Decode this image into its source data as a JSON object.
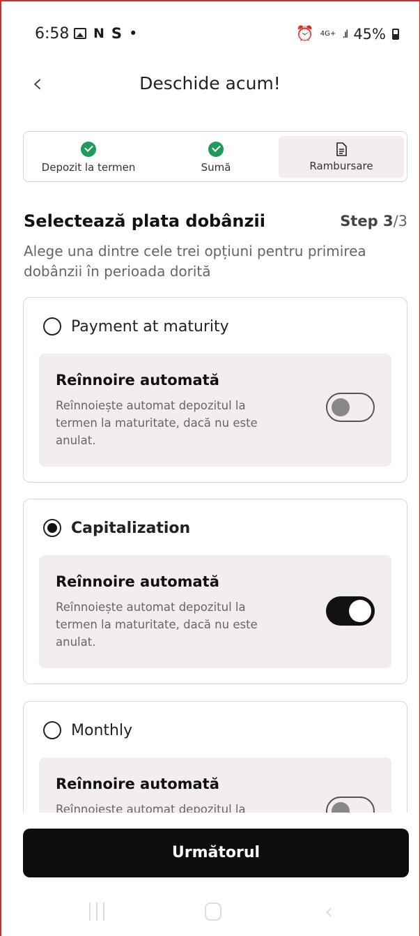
{
  "status_bar": {
    "time": "6:58",
    "left_icons": [
      "image-icon",
      "N",
      "S",
      "•"
    ],
    "network": "4G+",
    "battery": "45%"
  },
  "header": {
    "back_icon": "chevron-left-icon",
    "title": "Deschide acum!"
  },
  "stepper": {
    "steps": [
      {
        "label": "Depozit la termen",
        "state": "done",
        "icon": "check-circle-icon"
      },
      {
        "label": "Sumă",
        "state": "done",
        "icon": "check-circle-icon"
      },
      {
        "label": "Rambursare",
        "state": "active",
        "icon": "document-icon"
      }
    ],
    "done_color": "#1f9a5b"
  },
  "section": {
    "title": "Selectează plata dobânzii",
    "step_prefix": "Step ",
    "step_current": "3",
    "step_total": "/3",
    "description": "Alege una dintre cele trei opțiuni pentru primirea dobânzii în perioada dorită"
  },
  "options": [
    {
      "label": "Payment at maturity",
      "selected": false,
      "renew_title": "Reînnoire automată",
      "renew_desc": "Reînnoiește automat depozitul la termen la maturitate, dacă nu este anulat.",
      "toggle_on": false
    },
    {
      "label": "Capitalization",
      "selected": true,
      "renew_title": "Reînnoire automată",
      "renew_desc": "Reînnoiește automat depozitul la termen la maturitate, dacă nu este anulat.",
      "toggle_on": true
    },
    {
      "label": "Monthly",
      "selected": false,
      "renew_title": "Reînnoire automată",
      "renew_desc": "Reînnoieste automat depozitul la",
      "toggle_on": false
    }
  ],
  "next_button": {
    "label": "Următorul"
  },
  "colors": {
    "accent": "#0d0d0d",
    "panel": "#f3eeed",
    "border": "#d62b2b"
  }
}
